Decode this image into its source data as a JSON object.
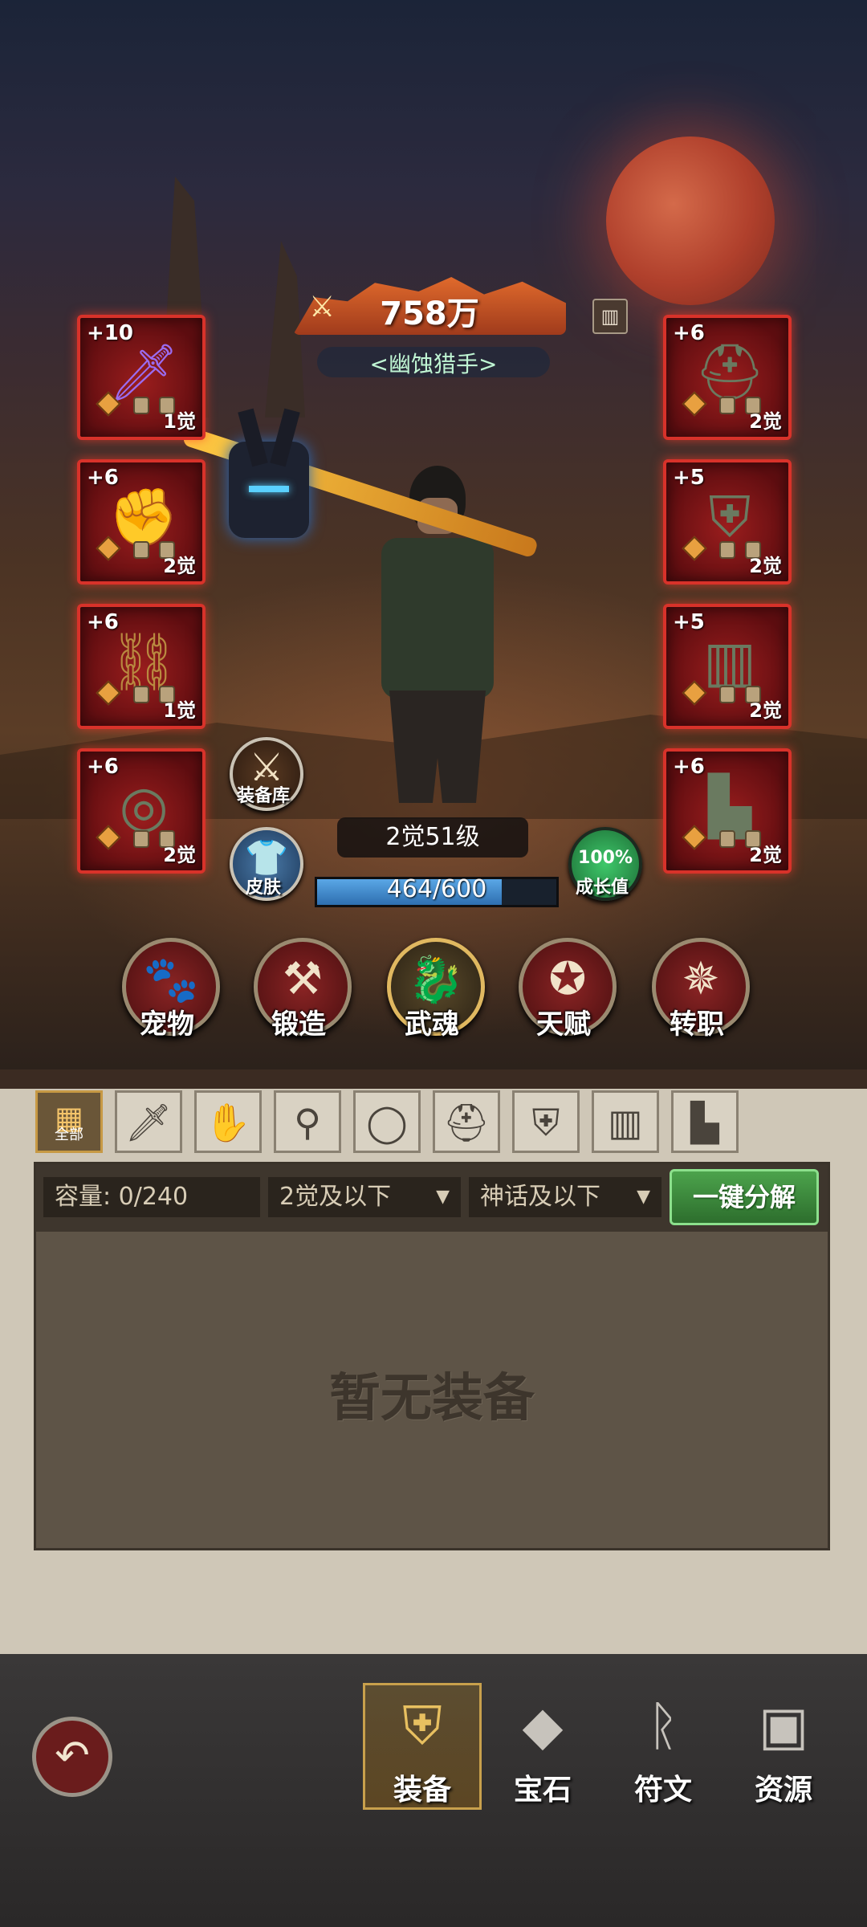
{
  "power": {
    "value": "758万"
  },
  "character": {
    "title": "<幽蚀猎手>",
    "level_text": "2觉51级",
    "xp_text": "464/600",
    "xp_fraction": 0.773
  },
  "side_buttons": {
    "armory": "装备库",
    "skin": "皮肤",
    "growth_percent": "100%",
    "growth_label": "成长值"
  },
  "left_slots": [
    {
      "plus": "+10",
      "awaken": "1觉",
      "icon": "purple-sword-icon"
    },
    {
      "plus": "+6",
      "awaken": "2觉",
      "icon": "gauntlet-icon"
    },
    {
      "plus": "+6",
      "awaken": "1觉",
      "icon": "amulet-chain-icon"
    },
    {
      "plus": "+6",
      "awaken": "2觉",
      "icon": "ring-icon"
    }
  ],
  "right_slots": [
    {
      "plus": "+6",
      "awaken": "2觉",
      "icon": "helmet-icon"
    },
    {
      "plus": "+5",
      "awaken": "2觉",
      "icon": "chest-armor-icon"
    },
    {
      "plus": "+5",
      "awaken": "2觉",
      "icon": "pants-icon"
    },
    {
      "plus": "+6",
      "awaken": "2觉",
      "icon": "boots-icon"
    }
  ],
  "menu": [
    {
      "label": "宠物",
      "icon": "paw-icon"
    },
    {
      "label": "锻造",
      "icon": "anvil-icon"
    },
    {
      "label": "武魂",
      "icon": "dragon-icon"
    },
    {
      "label": "天赋",
      "icon": "talent-emblem-icon"
    },
    {
      "label": "转职",
      "icon": "winged-star-icon"
    }
  ],
  "filter_tabs": [
    {
      "label": "全部",
      "icon": "all-grid-icon"
    },
    {
      "icon": "sword-icon"
    },
    {
      "icon": "glove-icon"
    },
    {
      "icon": "necklace-icon"
    },
    {
      "icon": "ring-icon"
    },
    {
      "icon": "helmet-icon"
    },
    {
      "icon": "armor-icon"
    },
    {
      "icon": "pants-icon"
    },
    {
      "icon": "boots-icon"
    }
  ],
  "inventory": {
    "capacity": "容量: 0/240",
    "awaken_filter": "2觉及以下",
    "quality_filter": "神话及以下",
    "decompose_button": "一键分解",
    "empty_text": "暂无装备"
  },
  "nav": [
    {
      "label": "装备",
      "icon": "equipment-armor-icon",
      "selected": true
    },
    {
      "label": "宝石",
      "icon": "gem-stone-icon",
      "selected": false
    },
    {
      "label": "符文",
      "icon": "rune-icon",
      "selected": false
    },
    {
      "label": "资源",
      "icon": "resource-chest-icon",
      "selected": false
    }
  ],
  "colors": {
    "slot_border": "#d8322a",
    "decompose_green": "#3f8f3f",
    "moon": "#c24a32",
    "xp_blue": "#4b8fd0"
  }
}
